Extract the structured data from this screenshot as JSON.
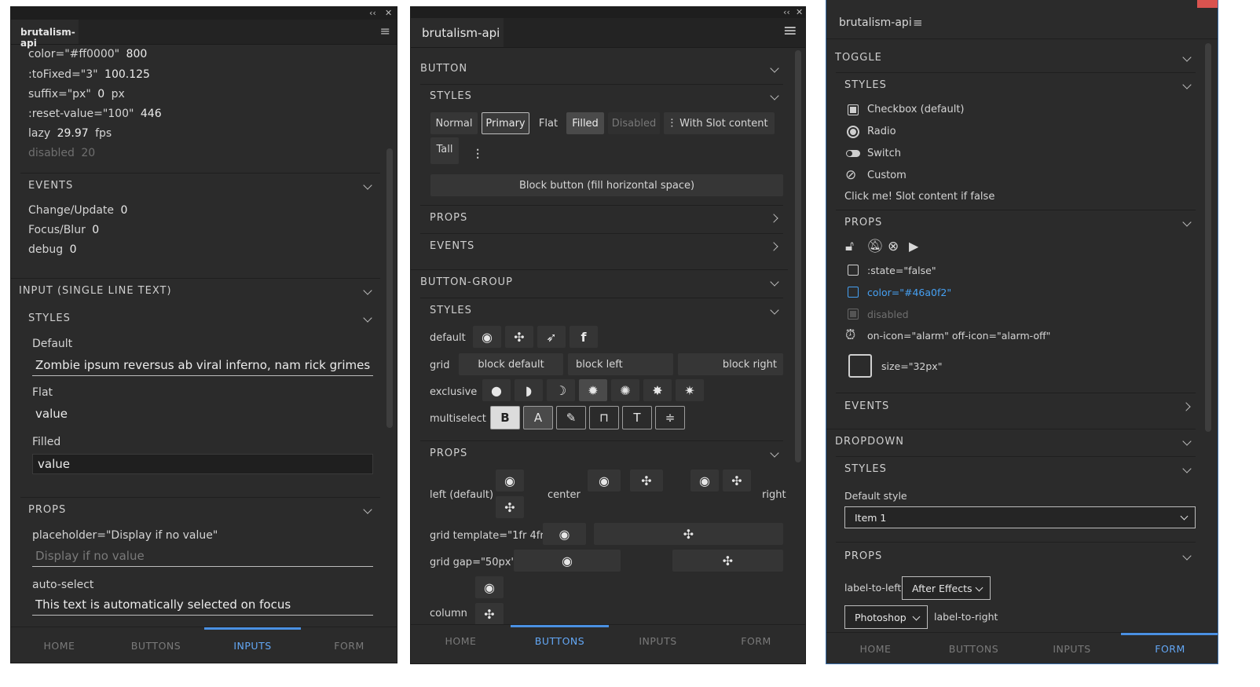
{
  "panel_title": "brutalism-api",
  "panel1": {
    "values": [
      {
        "label": "color=\"#ff0000\"",
        "value": "800"
      },
      {
        "label": ":toFixed=\"3\"",
        "value": "100.125"
      },
      {
        "label": "suffix=\"px\"",
        "value": "0",
        "unit": "px"
      },
      {
        "label": ":reset-value=\"100\"",
        "value": "446"
      },
      {
        "label": "lazy",
        "value": "29.97",
        "unit": "fps"
      },
      {
        "label": "disabled",
        "value": "20"
      }
    ],
    "events_title": "EVENTS",
    "events": [
      {
        "label": "Change/Update",
        "value": "0"
      },
      {
        "label": "Focus/Blur",
        "value": "0"
      },
      {
        "label": "debug",
        "value": "0"
      }
    ],
    "input_title": "INPUT (SINGLE LINE TEXT)",
    "styles_title": "STYLES",
    "default_label": "Default",
    "default_value": "Zombie ipsum reversus ab viral inferno, nam rick grimes …",
    "flat_label": "Flat",
    "flat_value": "value",
    "filled_label": "Filled",
    "filled_value": "value",
    "props_title": "PROPS",
    "placeholder_label": "placeholder=\"Display if no value\"",
    "placeholder_text": "Display if no value",
    "autoselect_label": "auto-select",
    "autoselect_value": "This text is automatically selected on focus"
  },
  "panel2": {
    "button_title": "BUTTON",
    "styles_title": "STYLES",
    "buttons": {
      "normal": "Normal",
      "primary": "Primary",
      "flat": "Flat",
      "filled": "Filled",
      "disabled": "Disabled",
      "slot": "With Slot content",
      "tall": "Tall",
      "block": "Block button (fill horizontal space)"
    },
    "props_title": "PROPS",
    "events_title": "EVENTS",
    "group_title": "BUTTON-GROUP",
    "group_rows": {
      "default": "default",
      "grid": "grid",
      "exclusive": "exclusive",
      "multiselect": "multiselect"
    },
    "grid_buttons": [
      "block default",
      "block left",
      "block right"
    ],
    "multiselect_letters": [
      "B",
      "A"
    ],
    "props_rows": {
      "left": "left (default)",
      "center": "center",
      "right": "right",
      "template": "grid template=\"1fr 4fr\"",
      "gap": "grid gap=\"50px\"",
      "column": "column"
    }
  },
  "panel3": {
    "toggle_title": "TOGGLE",
    "styles_title": "STYLES",
    "toggle_styles": [
      "Checkbox (default)",
      "Radio",
      "Switch",
      "Custom"
    ],
    "slot_text": "Click me! Slot content if false",
    "props_title": "PROPS",
    "props_rows": [
      ":state=\"false\"",
      "color=\"#46a0f2\"",
      "disabled",
      "on-icon=\"alarm\" off-icon=\"alarm-off\"",
      "size=\"32px\""
    ],
    "events_title": "EVENTS",
    "dropdown_title": "DROPDOWN",
    "default_style_label": "Default style",
    "default_select": "Item 1",
    "label_left": "label-to-left",
    "label_left_select": "After Effects",
    "label_right_select": "Photoshop",
    "label_right": "label-to-right"
  },
  "nav": [
    "HOME",
    "BUTTONS",
    "INPUTS",
    "FORM"
  ],
  "colors": {
    "accent": "#4a90e2",
    "active_text": "#63a7f5",
    "blue_label": "#46a0f2",
    "panel_bg": "#2b2b2b"
  }
}
